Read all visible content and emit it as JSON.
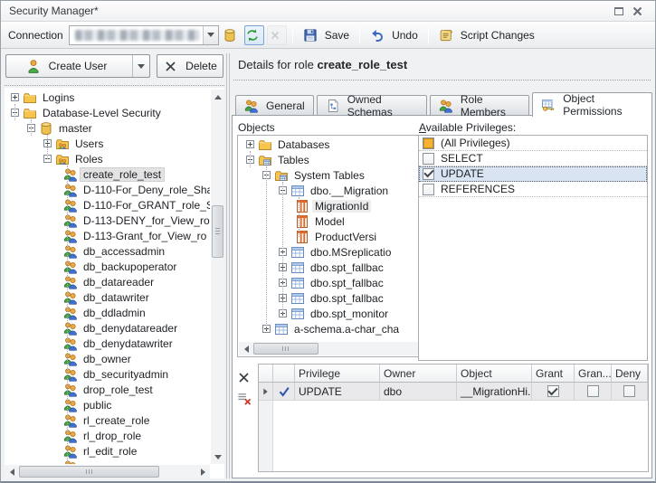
{
  "window": {
    "title": "Security Manager*"
  },
  "toolbar": {
    "connection_label": "Connection",
    "connection_redacted": true,
    "icon_buttons": [
      {
        "name": "connect-database",
        "icon": "database",
        "state": "normal"
      },
      {
        "name": "refresh-connection",
        "icon": "refresh",
        "state": "selected"
      },
      {
        "name": "cancel-connection",
        "icon": "x-gray",
        "state": "disabled"
      }
    ],
    "buttons": [
      {
        "label": "Save",
        "icon": "save"
      },
      {
        "label": "Undo",
        "icon": "undo"
      },
      {
        "label": "Script Changes",
        "icon": "script"
      }
    ]
  },
  "left_panel": {
    "create_user_label": "Create User",
    "delete_label": "Delete",
    "tree": [
      {
        "label": "Logins",
        "level": 0,
        "expand": "plus",
        "icon": "folder"
      },
      {
        "label": "Database-Level Security",
        "level": 0,
        "expand": "minus",
        "icon": "folder"
      },
      {
        "label": "master",
        "level": 1,
        "expand": "minus",
        "icon": "database"
      },
      {
        "label": "Users",
        "level": 2,
        "expand": "plus",
        "icon": "folder-users"
      },
      {
        "label": "Roles",
        "level": 2,
        "expand": "minus",
        "icon": "folder-users"
      },
      {
        "label": "create_role_test",
        "level": 3,
        "expand": "none",
        "icon": "role-users",
        "selected": true
      },
      {
        "label": "D-110-For_Deny_role_Sha",
        "level": 3,
        "expand": "none",
        "icon": "role-users"
      },
      {
        "label": "D-110-For_GRANT_role_S",
        "level": 3,
        "expand": "none",
        "icon": "role-users"
      },
      {
        "label": "D-113-DENY_for_View_ro",
        "level": 3,
        "expand": "none",
        "icon": "role-users"
      },
      {
        "label": "D-113-Grant_for_View_ro",
        "level": 3,
        "expand": "none",
        "icon": "role-users"
      },
      {
        "label": "db_accessadmin",
        "level": 3,
        "expand": "none",
        "icon": "role-users"
      },
      {
        "label": "db_backupoperator",
        "level": 3,
        "expand": "none",
        "icon": "role-users"
      },
      {
        "label": "db_datareader",
        "level": 3,
        "expand": "none",
        "icon": "role-users"
      },
      {
        "label": "db_datawriter",
        "level": 3,
        "expand": "none",
        "icon": "role-users"
      },
      {
        "label": "db_ddladmin",
        "level": 3,
        "expand": "none",
        "icon": "role-users"
      },
      {
        "label": "db_denydatareader",
        "level": 3,
        "expand": "none",
        "icon": "role-users"
      },
      {
        "label": "db_denydatawriter",
        "level": 3,
        "expand": "none",
        "icon": "role-users"
      },
      {
        "label": "db_owner",
        "level": 3,
        "expand": "none",
        "icon": "role-users"
      },
      {
        "label": "db_securityadmin",
        "level": 3,
        "expand": "none",
        "icon": "role-users"
      },
      {
        "label": "drop_role_test",
        "level": 3,
        "expand": "none",
        "icon": "role-users"
      },
      {
        "label": "public",
        "level": 3,
        "expand": "none",
        "icon": "role-users"
      },
      {
        "label": "rl_create_role",
        "level": 3,
        "expand": "none",
        "icon": "role-users"
      },
      {
        "label": "rl_drop_role",
        "level": 3,
        "expand": "none",
        "icon": "role-users"
      },
      {
        "label": "rl_edit_role",
        "level": 3,
        "expand": "none",
        "icon": "role-users"
      },
      {
        "label": "",
        "level": 3,
        "expand": "none",
        "icon": "role-users",
        "partial": true
      }
    ]
  },
  "details": {
    "prefix": "Details for role",
    "role_name": "create_role_test"
  },
  "tabs": [
    {
      "label": "General",
      "icon": "role-users",
      "active": false
    },
    {
      "label": "Owned Schemas",
      "icon": "schema-doc",
      "active": false
    },
    {
      "label": "Role Members",
      "icon": "role-users",
      "active": false
    },
    {
      "label": "Object Permissions",
      "icon": "key-table",
      "active": true
    }
  ],
  "objects_panel": {
    "label": "Objects",
    "tree": [
      {
        "label": "Databases",
        "level": 0,
        "expand": "plus",
        "icon": "folder"
      },
      {
        "label": "Tables",
        "level": 0,
        "expand": "minus",
        "icon": "folder-table"
      },
      {
        "label": "System Tables",
        "level": 1,
        "expand": "minus",
        "icon": "folder-table"
      },
      {
        "label": "dbo.__Migration",
        "level": 2,
        "expand": "minus",
        "icon": "table"
      },
      {
        "label": "MigrationId",
        "level": 3,
        "expand": "none",
        "icon": "column",
        "selected2": true
      },
      {
        "label": "Model",
        "level": 3,
        "expand": "none",
        "icon": "column"
      },
      {
        "label": "ProductVersi",
        "level": 3,
        "expand": "none",
        "icon": "column"
      },
      {
        "label": "dbo.MSreplicatio",
        "level": 2,
        "expand": "plus",
        "icon": "table"
      },
      {
        "label": "dbo.spt_fallbac",
        "level": 2,
        "expand": "plus",
        "icon": "table"
      },
      {
        "label": "dbo.spt_fallbac",
        "level": 2,
        "expand": "plus",
        "icon": "table"
      },
      {
        "label": "dbo.spt_fallbac",
        "level": 2,
        "expand": "plus",
        "icon": "table"
      },
      {
        "label": "dbo.spt_monitor",
        "level": 2,
        "expand": "plus",
        "icon": "table"
      },
      {
        "label": "a-schema.a-char_cha",
        "level": 1,
        "expand": "plus",
        "icon": "table"
      }
    ]
  },
  "privileges_panel": {
    "label_accel": "A",
    "label_rest": "vailable Privileges:",
    "items": [
      {
        "label": "(All Privileges)",
        "state": "indeterminate",
        "selected": false
      },
      {
        "label": "SELECT",
        "state": "unchecked",
        "selected": false
      },
      {
        "label": "UPDATE",
        "state": "checked",
        "selected": true
      },
      {
        "label": "REFERENCES",
        "state": "unchecked",
        "selected": false
      }
    ]
  },
  "permissions_grid": {
    "actions": [
      {
        "name": "delete-permission",
        "icon": "delete-x"
      },
      {
        "name": "revoke-all-permissions",
        "icon": "clear-all"
      }
    ],
    "columns": [
      "Privilege",
      "Owner",
      "Object",
      "Grant",
      "Gran...",
      "Deny"
    ],
    "rows": [
      {
        "privilege": "UPDATE",
        "owner": "dbo",
        "object": "__MigrationHi...",
        "grant": true,
        "grant_with": false,
        "deny": false
      }
    ]
  },
  "colors": {
    "selection_blue": "#d9e4f3",
    "selection_gray": "#e3e3e4",
    "indeterminate_fill": "#f7b231",
    "accent_green": "#43a047",
    "accent_blue": "#3f6fd1",
    "accent_amber": "#eec04f"
  }
}
